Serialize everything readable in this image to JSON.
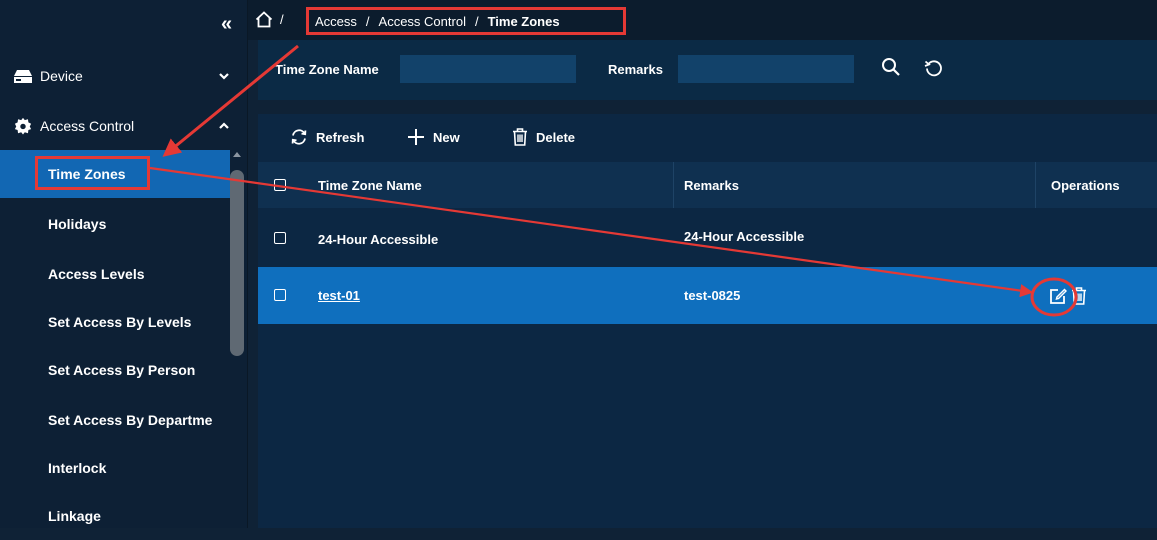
{
  "sidebar": {
    "collapse_icon": "double-chevron-left-icon",
    "groups": [
      {
        "label": "Device",
        "icon": "device-icon",
        "chevron": "chevron-down-icon"
      },
      {
        "label": "Access Control",
        "icon": "gear-icon",
        "chevron": "chevron-up-icon"
      }
    ],
    "submenu": [
      {
        "label": "Time Zones",
        "active": true
      },
      {
        "label": "Holidays"
      },
      {
        "label": "Access Levels"
      },
      {
        "label": "Set Access By Levels"
      },
      {
        "label": "Set Access By Person"
      },
      {
        "label": "Set Access By Departme"
      },
      {
        "label": "Interlock"
      },
      {
        "label": "Linkage"
      }
    ]
  },
  "breadcrumb": {
    "home_icon": "home-icon",
    "separator": "/",
    "items": [
      "Access",
      "Access Control",
      "Time Zones"
    ]
  },
  "filter": {
    "time_zone_name_label": "Time Zone Name",
    "time_zone_name_value": "",
    "remarks_label": "Remarks",
    "remarks_value": "",
    "search_icon": "search-icon",
    "reset_icon": "reset-icon"
  },
  "toolbar": {
    "refresh_label": "Refresh",
    "new_label": "New",
    "delete_label": "Delete"
  },
  "table": {
    "columns": [
      "Time Zone Name",
      "Remarks",
      "Operations"
    ],
    "rows": [
      {
        "name": "24-Hour Accessible",
        "remarks": "24-Hour Accessible",
        "selected": false
      },
      {
        "name": "test-01",
        "remarks": "test-0825",
        "selected": true
      }
    ]
  },
  "colors": {
    "active": "#1267b3",
    "selected_row": "#0f6fbe",
    "annotation": "#e53935"
  }
}
